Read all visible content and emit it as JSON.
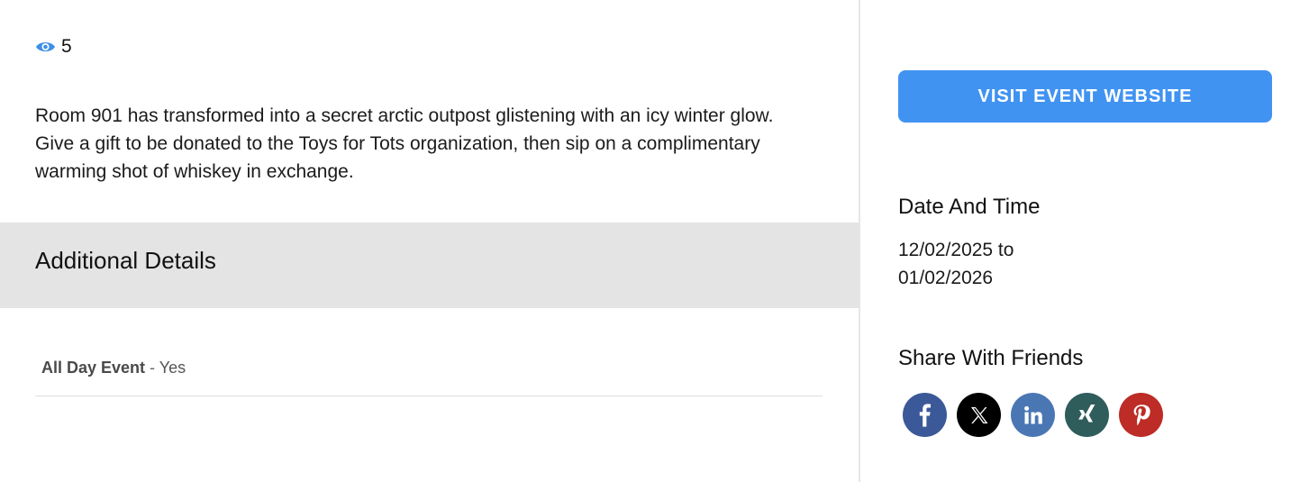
{
  "views": {
    "count": "5",
    "icon": "eye-icon"
  },
  "event": {
    "description": "Room 901 has transformed into a secret arctic outpost glistening with an icy winter glow. Give a gift to be donated to the Toys for Tots organization, then sip on a complimentary warming shot of whiskey in exchange."
  },
  "details": {
    "title": "Additional Details",
    "items": [
      {
        "label": "All Day Event",
        "separator": " - ",
        "value": "Yes"
      }
    ]
  },
  "sidebar": {
    "visit_button": "VISIT EVENT WEBSITE",
    "date_heading": "Date And Time",
    "date_start": "12/02/2025 to",
    "date_end": "01/02/2026",
    "share_heading": "Share With Friends",
    "share": [
      {
        "name": "facebook",
        "icon": "facebook-icon",
        "color": "#3b5998"
      },
      {
        "name": "x",
        "icon": "x-icon",
        "color": "#000000"
      },
      {
        "name": "linkedin",
        "icon": "linkedin-icon",
        "color": "#4a77b4"
      },
      {
        "name": "xing",
        "icon": "xing-icon",
        "color": "#2f5d5c"
      },
      {
        "name": "pinterest",
        "icon": "pinterest-icon",
        "color": "#bd2c26"
      }
    ]
  },
  "colors": {
    "accent": "#4193f2",
    "eye_icon": "#3d8fe8",
    "band": "#e4e4e4"
  }
}
